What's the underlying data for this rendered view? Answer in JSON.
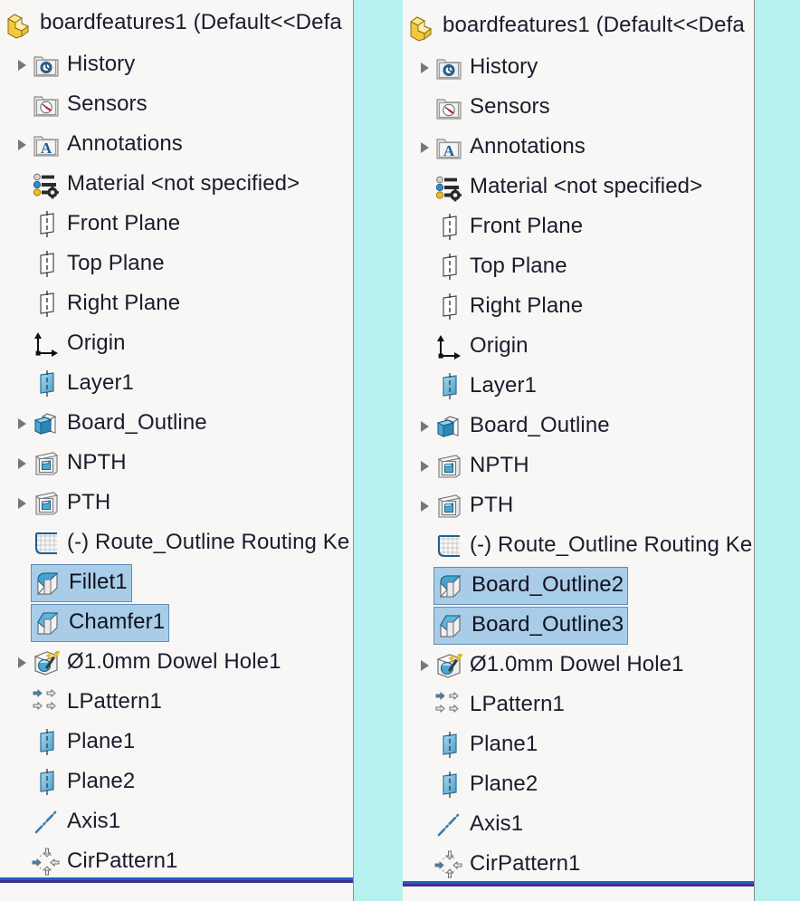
{
  "app": {
    "name": "SolidWorks FeatureManager Design Tree",
    "background_color": "#b6f0ef",
    "panel_background": "#f8f7f6",
    "selection_fill": "#a9cde8",
    "selection_border": "#5b8fb9",
    "rollback_bar_color": "#1f5fc7"
  },
  "panels": [
    {
      "id": "before",
      "title": "boardfeatures1  (Default<<Defa",
      "title_icon": "part-document-icon",
      "rollback_bar_label": "rollback-bar",
      "items": [
        {
          "label": "History",
          "icon": "history-folder-icon",
          "expandable": true,
          "indent": 1,
          "selected": false
        },
        {
          "label": "Sensors",
          "icon": "sensors-folder-icon",
          "expandable": false,
          "indent": 1,
          "selected": false
        },
        {
          "label": "Annotations",
          "icon": "annotations-folder-icon",
          "expandable": true,
          "indent": 1,
          "selected": false
        },
        {
          "label": "Material <not specified>",
          "icon": "material-icon",
          "expandable": false,
          "indent": 1,
          "selected": false
        },
        {
          "label": "Front Plane",
          "icon": "plane-icon",
          "expandable": false,
          "indent": 1,
          "selected": false
        },
        {
          "label": "Top Plane",
          "icon": "plane-icon",
          "expandable": false,
          "indent": 1,
          "selected": false
        },
        {
          "label": "Right Plane",
          "icon": "plane-icon",
          "expandable": false,
          "indent": 1,
          "selected": false
        },
        {
          "label": "Origin",
          "icon": "origin-icon",
          "expandable": false,
          "indent": 1,
          "selected": false
        },
        {
          "label": "Layer1",
          "icon": "reference-plane-icon",
          "expandable": false,
          "indent": 1,
          "selected": false
        },
        {
          "label": "Board_Outline",
          "icon": "extrude-boss-icon",
          "expandable": true,
          "indent": 1,
          "selected": false
        },
        {
          "label": "NPTH",
          "icon": "extrude-cut-icon",
          "expandable": true,
          "indent": 1,
          "selected": false
        },
        {
          "label": "PTH",
          "icon": "extrude-cut-icon",
          "expandable": true,
          "indent": 1,
          "selected": false
        },
        {
          "label": "(-) Route_Outline Routing Ke",
          "icon": "sketch-icon",
          "expandable": false,
          "indent": 1,
          "selected": false
        },
        {
          "label": "Fillet1",
          "icon": "fillet-icon",
          "expandable": false,
          "indent": 1,
          "selected": true
        },
        {
          "label": "Chamfer1",
          "icon": "chamfer-icon",
          "expandable": false,
          "indent": 1,
          "selected": true
        },
        {
          "label": "Ø1.0mm Dowel Hole1",
          "icon": "hole-wizard-icon",
          "expandable": true,
          "indent": 1,
          "selected": false
        },
        {
          "label": "LPattern1",
          "icon": "linear-pattern-icon",
          "expandable": false,
          "indent": 1,
          "selected": false
        },
        {
          "label": "Plane1",
          "icon": "reference-plane-icon",
          "expandable": false,
          "indent": 1,
          "selected": false
        },
        {
          "label": "Plane2",
          "icon": "reference-plane-icon",
          "expandable": false,
          "indent": 1,
          "selected": false
        },
        {
          "label": "Axis1",
          "icon": "axis-icon",
          "expandable": false,
          "indent": 1,
          "selected": false
        },
        {
          "label": "CirPattern1",
          "icon": "circular-pattern-icon",
          "expandable": false,
          "indent": 1,
          "selected": false
        }
      ]
    },
    {
      "id": "after",
      "title": "boardfeatures1  (Default<<Defa",
      "title_icon": "part-document-icon",
      "rollback_bar_label": "rollback-bar",
      "items": [
        {
          "label": "History",
          "icon": "history-folder-icon",
          "expandable": true,
          "indent": 1,
          "selected": false
        },
        {
          "label": "Sensors",
          "icon": "sensors-folder-icon",
          "expandable": false,
          "indent": 1,
          "selected": false
        },
        {
          "label": "Annotations",
          "icon": "annotations-folder-icon",
          "expandable": true,
          "indent": 1,
          "selected": false
        },
        {
          "label": "Material <not specified>",
          "icon": "material-icon",
          "expandable": false,
          "indent": 1,
          "selected": false
        },
        {
          "label": "Front Plane",
          "icon": "plane-icon",
          "expandable": false,
          "indent": 1,
          "selected": false
        },
        {
          "label": "Top Plane",
          "icon": "plane-icon",
          "expandable": false,
          "indent": 1,
          "selected": false
        },
        {
          "label": "Right Plane",
          "icon": "plane-icon",
          "expandable": false,
          "indent": 1,
          "selected": false
        },
        {
          "label": "Origin",
          "icon": "origin-icon",
          "expandable": false,
          "indent": 1,
          "selected": false
        },
        {
          "label": "Layer1",
          "icon": "reference-plane-icon",
          "expandable": false,
          "indent": 1,
          "selected": false
        },
        {
          "label": "Board_Outline",
          "icon": "extrude-boss-icon",
          "expandable": true,
          "indent": 1,
          "selected": false
        },
        {
          "label": "NPTH",
          "icon": "extrude-cut-icon",
          "expandable": true,
          "indent": 1,
          "selected": false
        },
        {
          "label": "PTH",
          "icon": "extrude-cut-icon",
          "expandable": true,
          "indent": 1,
          "selected": false
        },
        {
          "label": "(-) Route_Outline Routing Ke",
          "icon": "sketch-icon",
          "expandable": false,
          "indent": 1,
          "selected": false
        },
        {
          "label": "Board_Outline2",
          "icon": "fillet-icon",
          "expandable": false,
          "indent": 1,
          "selected": true
        },
        {
          "label": "Board_Outline3",
          "icon": "chamfer-icon",
          "expandable": false,
          "indent": 1,
          "selected": true
        },
        {
          "label": "Ø1.0mm Dowel Hole1",
          "icon": "hole-wizard-icon",
          "expandable": true,
          "indent": 1,
          "selected": false
        },
        {
          "label": "LPattern1",
          "icon": "linear-pattern-icon",
          "expandable": false,
          "indent": 1,
          "selected": false
        },
        {
          "label": "Plane1",
          "icon": "reference-plane-icon",
          "expandable": false,
          "indent": 1,
          "selected": false
        },
        {
          "label": "Plane2",
          "icon": "reference-plane-icon",
          "expandable": false,
          "indent": 1,
          "selected": false
        },
        {
          "label": "Axis1",
          "icon": "axis-icon",
          "expandable": false,
          "indent": 1,
          "selected": false
        },
        {
          "label": "CirPattern1",
          "icon": "circular-pattern-icon",
          "expandable": false,
          "indent": 1,
          "selected": false
        }
      ]
    }
  ]
}
